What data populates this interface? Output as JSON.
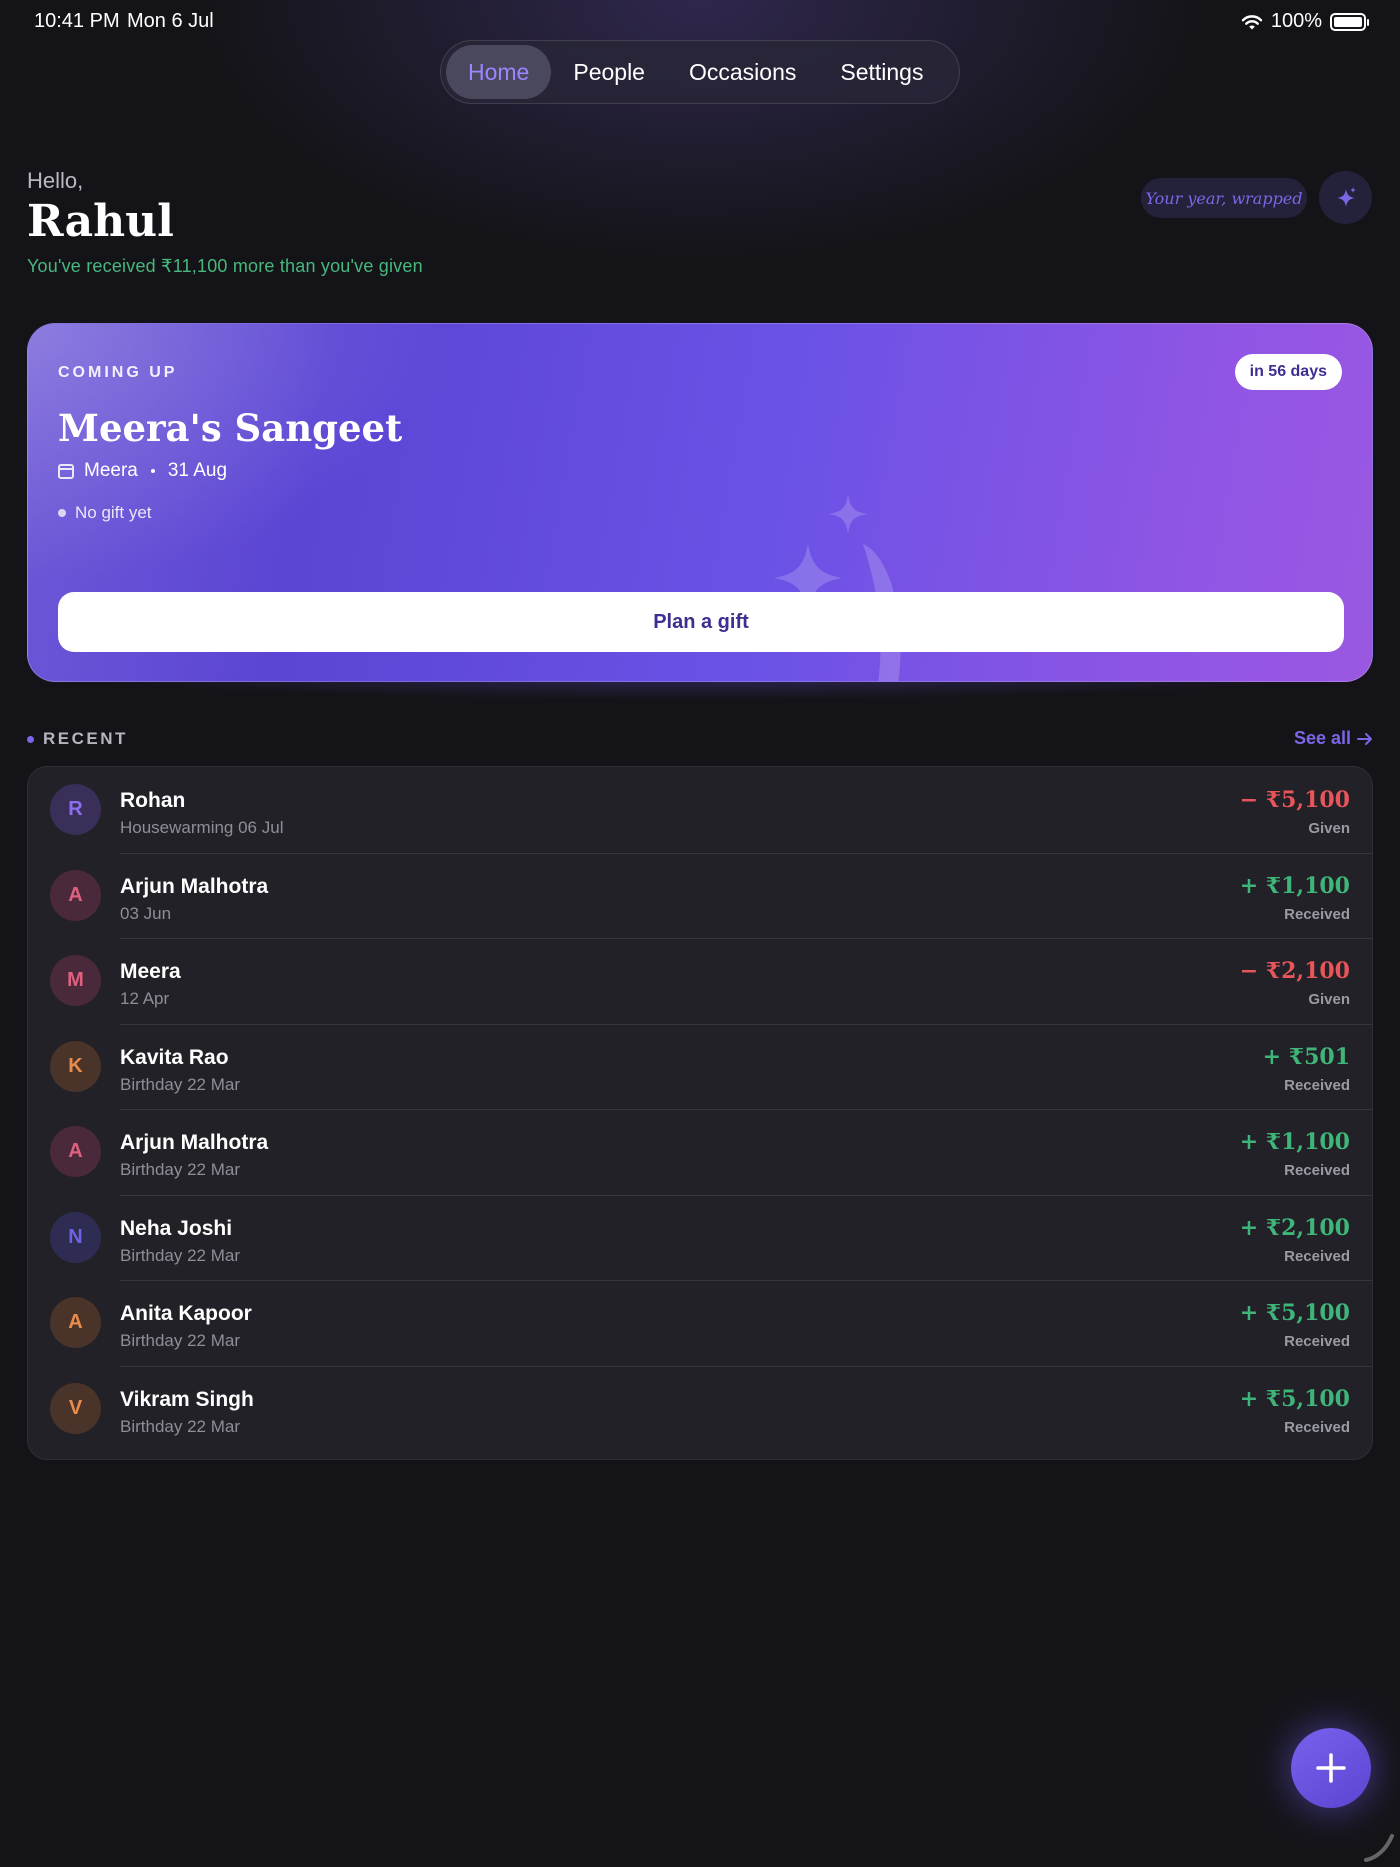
{
  "status_bar": {
    "time": "10:41 PM",
    "date": "Mon 6 Jul",
    "battery": "100%"
  },
  "tabs": [
    {
      "label": "Home",
      "active": true
    },
    {
      "label": "People",
      "active": false
    },
    {
      "label": "Occasions",
      "active": false
    },
    {
      "label": "Settings",
      "active": false
    }
  ],
  "greeting": {
    "hello": "Hello,",
    "name": "Rahul",
    "summary": "You've received ₹11,100 more than you've given",
    "wrapped_label": "Your year, wrapped"
  },
  "coming_up": {
    "eyebrow": "COMING UP",
    "days_badge": "in 56 days",
    "title": "Meera's Sangeet",
    "person": "Meera",
    "date": "31 Aug",
    "status": "No gift yet",
    "button": "Plan a gift"
  },
  "recent": {
    "label": "RECENT",
    "see_all": "See all",
    "items": [
      {
        "initial": "R",
        "name": "Rohan",
        "sub": "Housewarming  06 Jul",
        "amount": "− ₹5,100",
        "type": "Given",
        "direction": "given",
        "avatar_bg": "#3a2f58",
        "avatar_fg": "#8e6ef0"
      },
      {
        "initial": "A",
        "name": "Arjun Malhotra",
        "sub": "03 Jun",
        "amount": "+ ₹1,100",
        "type": "Received",
        "direction": "received",
        "avatar_bg": "#4a2a3a",
        "avatar_fg": "#e0607e"
      },
      {
        "initial": "M",
        "name": "Meera",
        "sub": "12 Apr",
        "amount": "− ₹2,100",
        "type": "Given",
        "direction": "given",
        "avatar_bg": "#4a2a3a",
        "avatar_fg": "#e0607e"
      },
      {
        "initial": "K",
        "name": "Kavita Rao",
        "sub": "Birthday  22 Mar",
        "amount": "+ ₹501",
        "type": "Received",
        "direction": "received",
        "avatar_bg": "#4a3328",
        "avatar_fg": "#e88c4e"
      },
      {
        "initial": "A",
        "name": "Arjun Malhotra",
        "sub": "Birthday  22 Mar",
        "amount": "+ ₹1,100",
        "type": "Received",
        "direction": "received",
        "avatar_bg": "#4a2a3a",
        "avatar_fg": "#e0607e"
      },
      {
        "initial": "N",
        "name": "Neha Joshi",
        "sub": "Birthday  22 Mar",
        "amount": "+ ₹2,100",
        "type": "Received",
        "direction": "received",
        "avatar_bg": "#2e2c52",
        "avatar_fg": "#6f62e0"
      },
      {
        "initial": "A",
        "name": "Anita Kapoor",
        "sub": "Birthday  22 Mar",
        "amount": "+ ₹5,100",
        "type": "Received",
        "direction": "received",
        "avatar_bg": "#4a3328",
        "avatar_fg": "#e88c4e"
      },
      {
        "initial": "V",
        "name": "Vikram Singh",
        "sub": "Birthday  22 Mar",
        "amount": "+ ₹5,100",
        "type": "Received",
        "direction": "received",
        "avatar_bg": "#4a3328",
        "avatar_fg": "#e88c4e"
      }
    ]
  },
  "colors": {
    "accent": "#7b67e6",
    "given": "#e8555a",
    "received": "#3fb57a",
    "background": "#141418",
    "list_bg": "#212127"
  },
  "icons": {
    "sparkle": "sparkle-icon",
    "calendar": "calendar-icon",
    "arrow": "arrow-right-icon",
    "add": "plus-icon",
    "wifi": "wifi-icon",
    "battery": "battery-icon"
  }
}
